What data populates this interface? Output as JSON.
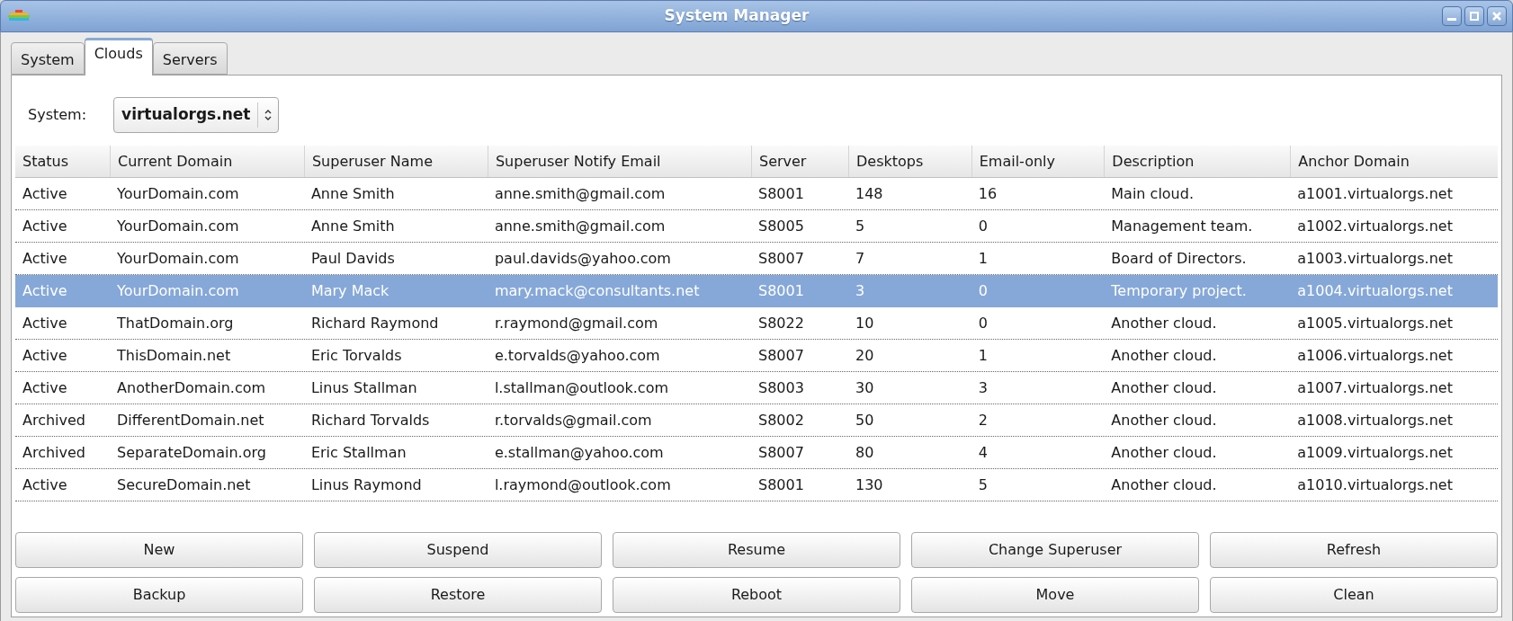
{
  "window": {
    "title": "System Manager"
  },
  "tabs": [
    {
      "label": "System",
      "selected": false
    },
    {
      "label": "Clouds",
      "selected": true
    },
    {
      "label": "Servers",
      "selected": false
    }
  ],
  "system_select": {
    "label": "System:",
    "value": "virtualorgs.net"
  },
  "table": {
    "columns": [
      "Status",
      "Current Domain",
      "Superuser Name",
      "Superuser Notify Email",
      "Server",
      "Desktops",
      "Email-only",
      "Description",
      "Anchor Domain"
    ],
    "rows": [
      {
        "selected": false,
        "cells": [
          "Active",
          "YourDomain.com",
          "Anne Smith",
          "anne.smith@gmail.com",
          "S8001",
          "148",
          "16",
          "Main cloud.",
          "a1001.virtualorgs.net"
        ]
      },
      {
        "selected": false,
        "cells": [
          "Active",
          "YourDomain.com",
          "Anne Smith",
          "anne.smith@gmail.com",
          "S8005",
          "5",
          "0",
          "Management team.",
          "a1002.virtualorgs.net"
        ]
      },
      {
        "selected": false,
        "cells": [
          "Active",
          "YourDomain.com",
          "Paul Davids",
          "paul.davids@yahoo.com",
          "S8007",
          "7",
          "1",
          "Board of Directors.",
          "a1003.virtualorgs.net"
        ]
      },
      {
        "selected": true,
        "cells": [
          "Active",
          "YourDomain.com",
          "Mary Mack",
          "mary.mack@consultants.net",
          "S8001",
          "3",
          "0",
          "Temporary project.",
          "a1004.virtualorgs.net"
        ]
      },
      {
        "selected": false,
        "cells": [
          "Active",
          "ThatDomain.org",
          "Richard Raymond",
          "r.raymond@gmail.com",
          "S8022",
          "10",
          "0",
          "Another cloud.",
          "a1005.virtualorgs.net"
        ]
      },
      {
        "selected": false,
        "cells": [
          "Active",
          "ThisDomain.net",
          "Eric Torvalds",
          "e.torvalds@yahoo.com",
          "S8007",
          "20",
          "1",
          "Another cloud.",
          "a1006.virtualorgs.net"
        ]
      },
      {
        "selected": false,
        "cells": [
          "Active",
          "AnotherDomain.com",
          "Linus Stallman",
          "l.stallman@outlook.com",
          "S8003",
          "30",
          "3",
          "Another cloud.",
          "a1007.virtualorgs.net"
        ]
      },
      {
        "selected": false,
        "cells": [
          "Archived",
          "DifferentDomain.net",
          "Richard Torvalds",
          "r.torvalds@gmail.com",
          "S8002",
          "50",
          "2",
          "Another cloud.",
          "a1008.virtualorgs.net"
        ]
      },
      {
        "selected": false,
        "cells": [
          "Archived",
          "SeparateDomain.org",
          "Eric Stallman",
          "e.stallman@yahoo.com",
          "S8007",
          "80",
          "4",
          "Another cloud.",
          "a1009.virtualorgs.net"
        ]
      },
      {
        "selected": false,
        "cells": [
          "Active",
          "SecureDomain.net",
          "Linus Raymond",
          "l.raymond@outlook.com",
          "S8001",
          "130",
          "5",
          "Another cloud.",
          "a1010.virtualorgs.net"
        ]
      }
    ]
  },
  "buttons": [
    [
      "New",
      "Suspend",
      "Resume",
      "Change Superuser",
      "Refresh"
    ],
    [
      "Backup",
      "Restore",
      "Reboot",
      "Move",
      "Clean"
    ]
  ]
}
